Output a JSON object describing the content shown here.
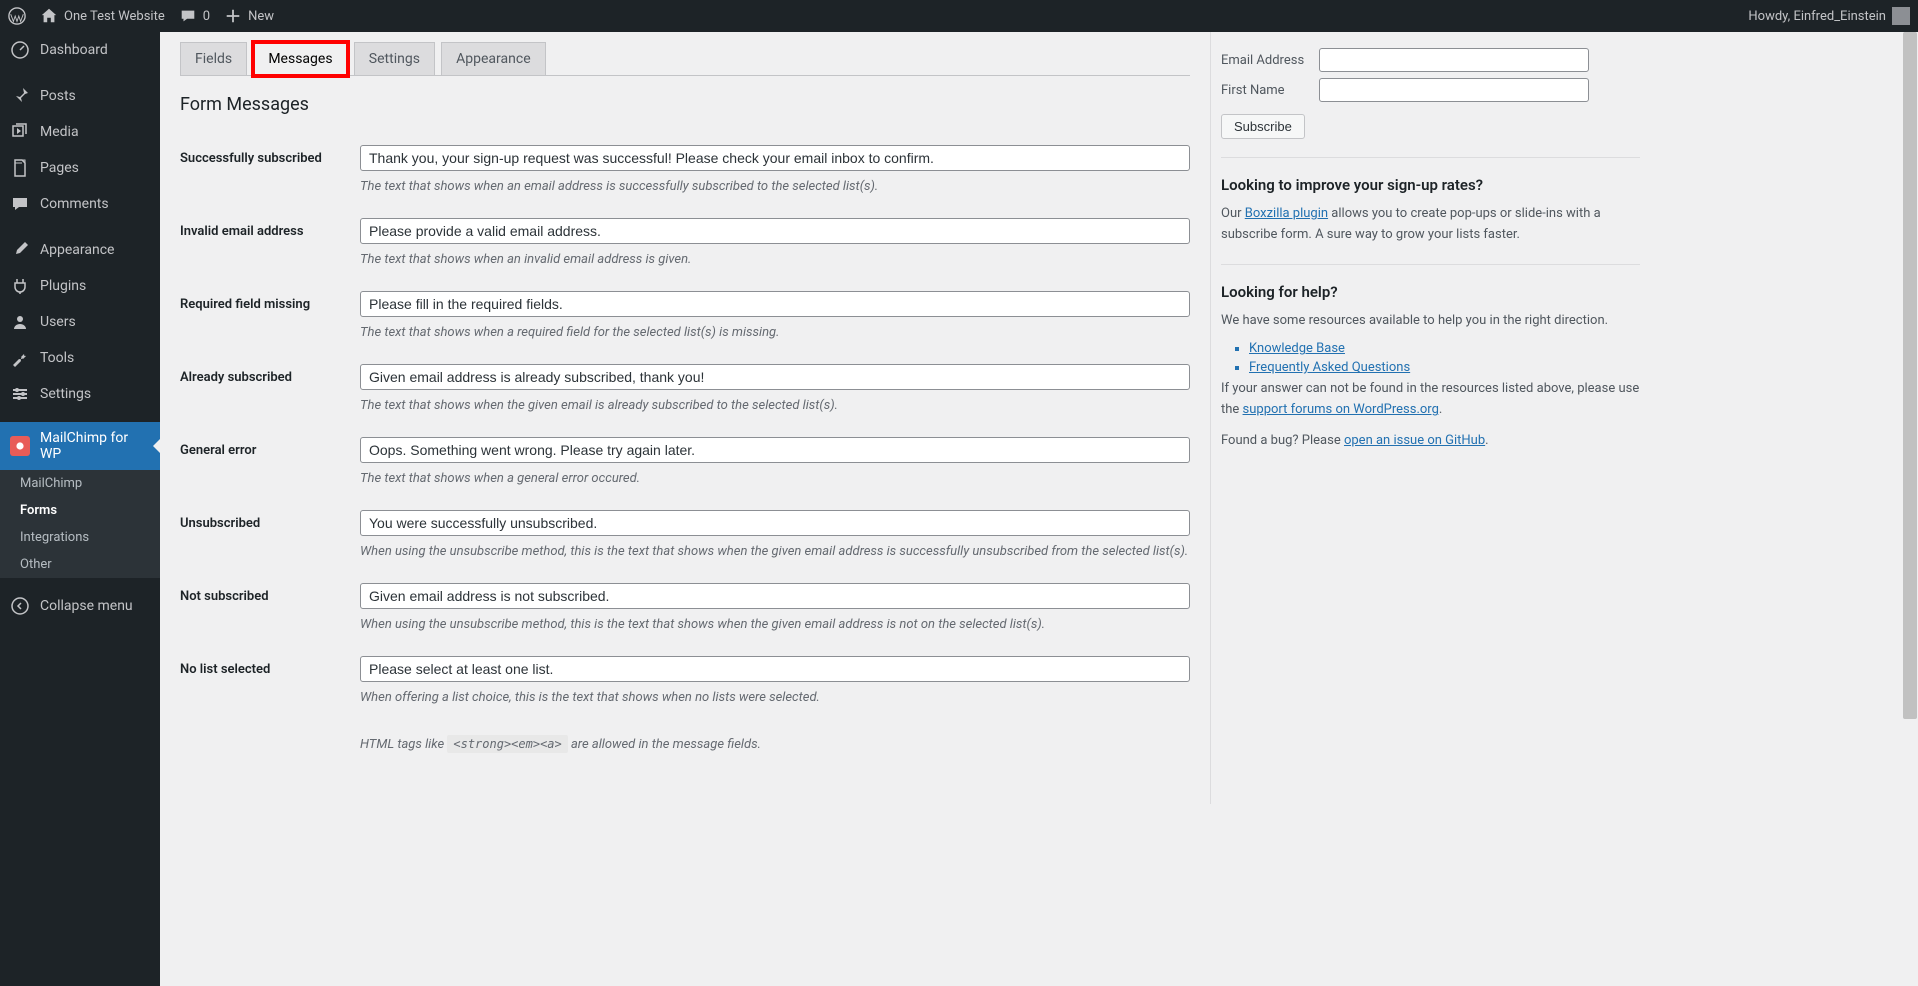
{
  "adminbar": {
    "site_name": "One Test Website",
    "comment_count": "0",
    "new_label": "New",
    "howdy_prefix": "Howdy, ",
    "user_display": "Einfred_Einstein"
  },
  "adminmenu": {
    "items": [
      {
        "slug": "dashboard",
        "label": "Dashboard"
      },
      {
        "slug": "posts",
        "label": "Posts"
      },
      {
        "slug": "media",
        "label": "Media"
      },
      {
        "slug": "pages",
        "label": "Pages"
      },
      {
        "slug": "comments",
        "label": "Comments"
      },
      {
        "slug": "appearance",
        "label": "Appearance"
      },
      {
        "slug": "plugins",
        "label": "Plugins"
      },
      {
        "slug": "users",
        "label": "Users"
      },
      {
        "slug": "tools",
        "label": "Tools"
      },
      {
        "slug": "settings",
        "label": "Settings"
      },
      {
        "slug": "mc4wp",
        "label": "MailChimp for WP"
      }
    ],
    "submenu": [
      {
        "slug": "mailchimp",
        "label": "MailChimp"
      },
      {
        "slug": "forms",
        "label": "Forms"
      },
      {
        "slug": "integrations",
        "label": "Integrations"
      },
      {
        "slug": "other",
        "label": "Other"
      }
    ],
    "collapse_label": "Collapse menu"
  },
  "tabs": {
    "fields": "Fields",
    "messages": "Messages",
    "settings": "Settings",
    "appearance": "Appearance"
  },
  "section_heading": "Form Messages",
  "fields": {
    "subscribed": {
      "label": "Successfully subscribed",
      "value": "Thank you, your sign-up request was successful! Please check your email inbox to confirm.",
      "desc": "The text that shows when an email address is successfully subscribed to the selected list(s)."
    },
    "invalid_email": {
      "label": "Invalid email address",
      "value": "Please provide a valid email address.",
      "desc": "The text that shows when an invalid email address is given."
    },
    "required_missing": {
      "label": "Required field missing",
      "value": "Please fill in the required fields.",
      "desc": "The text that shows when a required field for the selected list(s) is missing."
    },
    "already_subscribed": {
      "label": "Already subscribed",
      "value": "Given email address is already subscribed, thank you!",
      "desc": "The text that shows when the given email is already subscribed to the selected list(s)."
    },
    "general_error": {
      "label": "General error",
      "value": "Oops. Something went wrong. Please try again later.",
      "desc": "The text that shows when a general error occured."
    },
    "unsubscribed": {
      "label": "Unsubscribed",
      "value": "You were successfully unsubscribed.",
      "desc": "When using the unsubscribe method, this is the text that shows when the given email address is successfully unsubscribed from the selected list(s)."
    },
    "not_subscribed": {
      "label": "Not subscribed",
      "value": "Given email address is not subscribed.",
      "desc": "When using the unsubscribe method, this is the text that shows when the given email address is not on the selected list(s)."
    },
    "no_list": {
      "label": "No list selected",
      "value": "Please select at least one list.",
      "desc": "When offering a list choice, this is the text that shows when no lists were selected."
    }
  },
  "tags_note": {
    "pre": "HTML tags like ",
    "code": "<strong><em><a>",
    "post": " are allowed in the message fields."
  },
  "sidebar": {
    "signup": {
      "email_label": "Email Address",
      "first_name_label": "First Name",
      "subscribe": "Subscribe"
    },
    "rates": {
      "heading": "Looking to improve your sign-up rates?",
      "pre": "Our ",
      "link": "Boxzilla plugin",
      "post": " allows you to create pop-ups or slide-ins with a subscribe form. A sure way to grow your lists faster."
    },
    "help": {
      "heading": "Looking for help?",
      "intro": "We have some resources available to help you in the right direction.",
      "kb": "Knowledge Base",
      "faq": "Frequently Asked Questions",
      "noanswer_pre": "If your answer can not be found in the resources listed above, please use the ",
      "noanswer_link": "support forums on WordPress.org",
      "bug_pre": "Found a bug? Please ",
      "bug_link": "open an issue on GitHub"
    }
  }
}
